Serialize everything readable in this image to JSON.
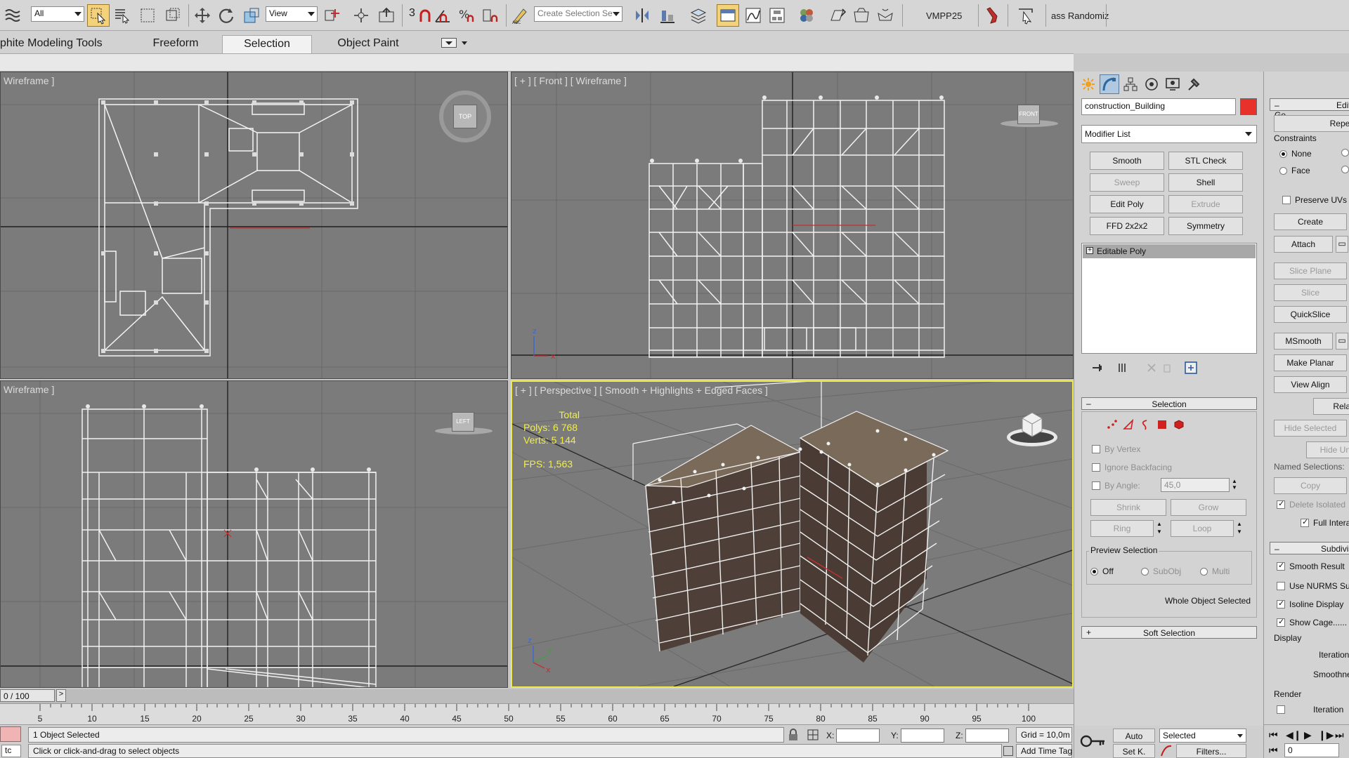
{
  "toolbar": {
    "filter_value": "All",
    "ref_coord_value": "View",
    "snap_label": "3",
    "selection_set_placeholder": "Create Selection Se",
    "plugin_label": "VMPP25",
    "randomizer_label": "ass Randomiz"
  },
  "ribbon": {
    "tabs": [
      "phite Modeling Tools",
      "Freeform",
      "Selection",
      "Object Paint"
    ],
    "active_tab": "Selection"
  },
  "viewports": {
    "top": {
      "label": "Wireframe ]"
    },
    "front": {
      "label": "[ + ] [ Front ] [ Wireframe ]",
      "viewcube": "FRONT"
    },
    "left": {
      "label": "Wireframe ]",
      "viewcube": "LEFT"
    },
    "perspective": {
      "label": "[ + ] [ Perspective ] [ Smooth + Highlights + Edged Faces ]",
      "stats_total": "Total",
      "polys": "Polys: 6 768",
      "verts": "Verts: 5 144",
      "fps": "FPS:   1,563"
    },
    "top_viewcube": "TOP"
  },
  "timeline": {
    "frame": "0 / 100",
    "arrow": ">",
    "ticks": [
      "5",
      "10",
      "15",
      "20",
      "25",
      "30",
      "35",
      "40",
      "45",
      "50",
      "55",
      "60",
      "65",
      "70",
      "75",
      "80",
      "85",
      "90",
      "95",
      "100"
    ]
  },
  "status": {
    "maxscript": "tc",
    "selected_count": "1 Object Selected",
    "prompt": "Click or click-and-drag to select objects",
    "x_label": "X:",
    "y_label": "Y:",
    "z_label": "Z:",
    "grid": "Grid = 10,0m",
    "add_time_tag": "Add Time Tag",
    "auto_key": "Auto",
    "set_key": "Set K.",
    "selected_dropdown": "Selected",
    "filters": "Filters...",
    "frame_field": "0"
  },
  "command_panel": {
    "object_name": "construction_Building",
    "object_color": "#e8312a",
    "modifier_list": "Modifier List",
    "modifier_buttons": [
      {
        "label": "Smooth",
        "enabled": true
      },
      {
        "label": "STL Check",
        "enabled": true
      },
      {
        "label": "Sweep",
        "enabled": false
      },
      {
        "label": "Shell",
        "enabled": true
      },
      {
        "label": "Edit Poly",
        "enabled": true
      },
      {
        "label": "Extrude",
        "enabled": false
      },
      {
        "label": "FFD 2x2x2",
        "enabled": true
      },
      {
        "label": "Symmetry",
        "enabled": true
      }
    ],
    "stack_item": "Editable Poly",
    "selection_rollout": {
      "title": "Selection",
      "by_vertex": "By Vertex",
      "ignore_backfacing": "Ignore Backfacing",
      "by_angle": "By Angle:",
      "angle_value": "45,0",
      "shrink": "Shrink",
      "grow": "Grow",
      "ring": "Ring",
      "loop": "Loop",
      "preview_title": "Preview Selection",
      "preview_off": "Off",
      "preview_subobj": "SubObj",
      "preview_multi": "Multi",
      "whole_object": "Whole Object Selected"
    },
    "soft_selection_title": "Soft Selection"
  },
  "edit_panel": {
    "title": "Edit Ge",
    "repeat": "Repea",
    "constraints": "Constraints",
    "none": "None",
    "face": "Face",
    "preserve_uvs": "Preserve UVs",
    "create": "Create",
    "attach": "Attach",
    "slice_plane": "Slice Plane",
    "slice": "Slice",
    "quickslice": "QuickSlice",
    "msmooth": "MSmooth",
    "make_planar": "Make Planar",
    "view_align": "View Align",
    "relax": "Relax",
    "hide_selected": "Hide Selected",
    "hide_unselected": "Hide Uns",
    "named_selections": "Named Selections:",
    "copy": "Copy",
    "delete_isolated": "Delete Isolated",
    "full_interactivity": "Full Intera",
    "subdivision_title": "Subdivis",
    "smooth_result": "Smooth Result",
    "use_nurms": "Use NURMS Sub",
    "isoline_display": "Isoline Display",
    "show_cage": "Show Cage......",
    "display_label": "Display",
    "iterations": "Iteration",
    "smoothness": "Smoothnes",
    "render_label": "Render",
    "render_iterations": "Iteration"
  }
}
